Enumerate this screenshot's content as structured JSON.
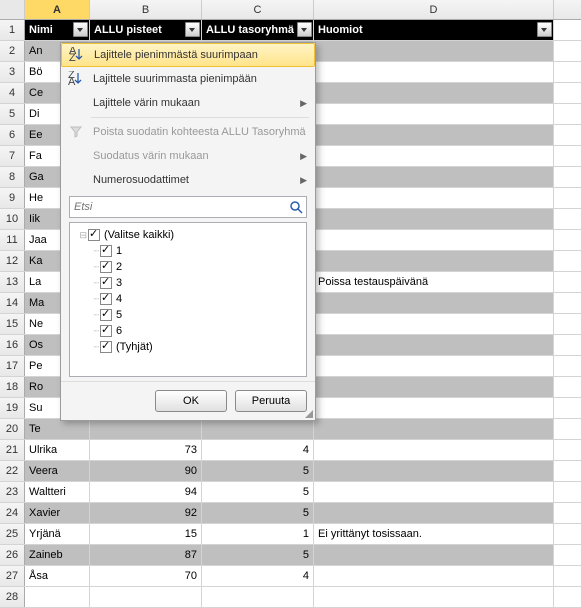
{
  "columns": [
    "A",
    "B",
    "C",
    "D"
  ],
  "header": {
    "A": "Nimi",
    "B": "ALLU pisteet",
    "C": "ALLU tasoryhmä",
    "D": "Huomiot"
  },
  "rows": [
    {
      "n": 2,
      "A": "An"
    },
    {
      "n": 3,
      "A": "Bö"
    },
    {
      "n": 4,
      "A": "Ce"
    },
    {
      "n": 5,
      "A": "Di"
    },
    {
      "n": 6,
      "A": "Ee"
    },
    {
      "n": 7,
      "A": "Fa"
    },
    {
      "n": 8,
      "A": "Ga"
    },
    {
      "n": 9,
      "A": "He"
    },
    {
      "n": 10,
      "A": "Iik"
    },
    {
      "n": 11,
      "A": "Jaa"
    },
    {
      "n": 12,
      "A": "Ka"
    },
    {
      "n": 13,
      "A": "La",
      "D": "Poissa testauspäivänä"
    },
    {
      "n": 14,
      "A": "Ma"
    },
    {
      "n": 15,
      "A": "Ne"
    },
    {
      "n": 16,
      "A": "Os"
    },
    {
      "n": 17,
      "A": "Pe"
    },
    {
      "n": 18,
      "A": "Ro"
    },
    {
      "n": 19,
      "A": "Su"
    },
    {
      "n": 20,
      "A": "Te"
    },
    {
      "n": 21,
      "A": "Ulrika",
      "B": "73",
      "C": "4"
    },
    {
      "n": 22,
      "A": "Veera",
      "B": "90",
      "C": "5"
    },
    {
      "n": 23,
      "A": "Waltteri",
      "B": "94",
      "C": "5"
    },
    {
      "n": 24,
      "A": "Xavier",
      "B": "92",
      "C": "5"
    },
    {
      "n": 25,
      "A": "Yrjänä",
      "B": "15",
      "C": "1",
      "D": "Ei yrittänyt tosissaan."
    },
    {
      "n": 26,
      "A": "Zaineb",
      "B": "87",
      "C": "5"
    },
    {
      "n": 27,
      "A": "Åsa",
      "B": "70",
      "C": "4"
    },
    {
      "n": 28,
      "A": ""
    }
  ],
  "stripedRows": [
    2,
    4,
    6,
    8,
    10,
    12,
    14,
    16,
    18,
    20,
    22,
    24,
    26
  ],
  "filterMenu": {
    "sortAsc": "Lajittele pienimmästä suurimpaan",
    "sortDesc": "Lajittele suurimmasta pienimpään",
    "sortColor": "Lajittele värin mukaan",
    "clearFilter": "Poista suodatin kohteesta ALLU Tasoryhmä",
    "filterColor": "Suodatus värin mukaan",
    "numberFilters": "Numerosuodattimet",
    "searchPlaceholder": "Etsi",
    "selectAll": "(Valitse kaikki)",
    "options": [
      "1",
      "2",
      "3",
      "4",
      "5",
      "6"
    ],
    "blanks": "(Tyhjät)",
    "ok": "OK",
    "cancel": "Peruuta"
  }
}
